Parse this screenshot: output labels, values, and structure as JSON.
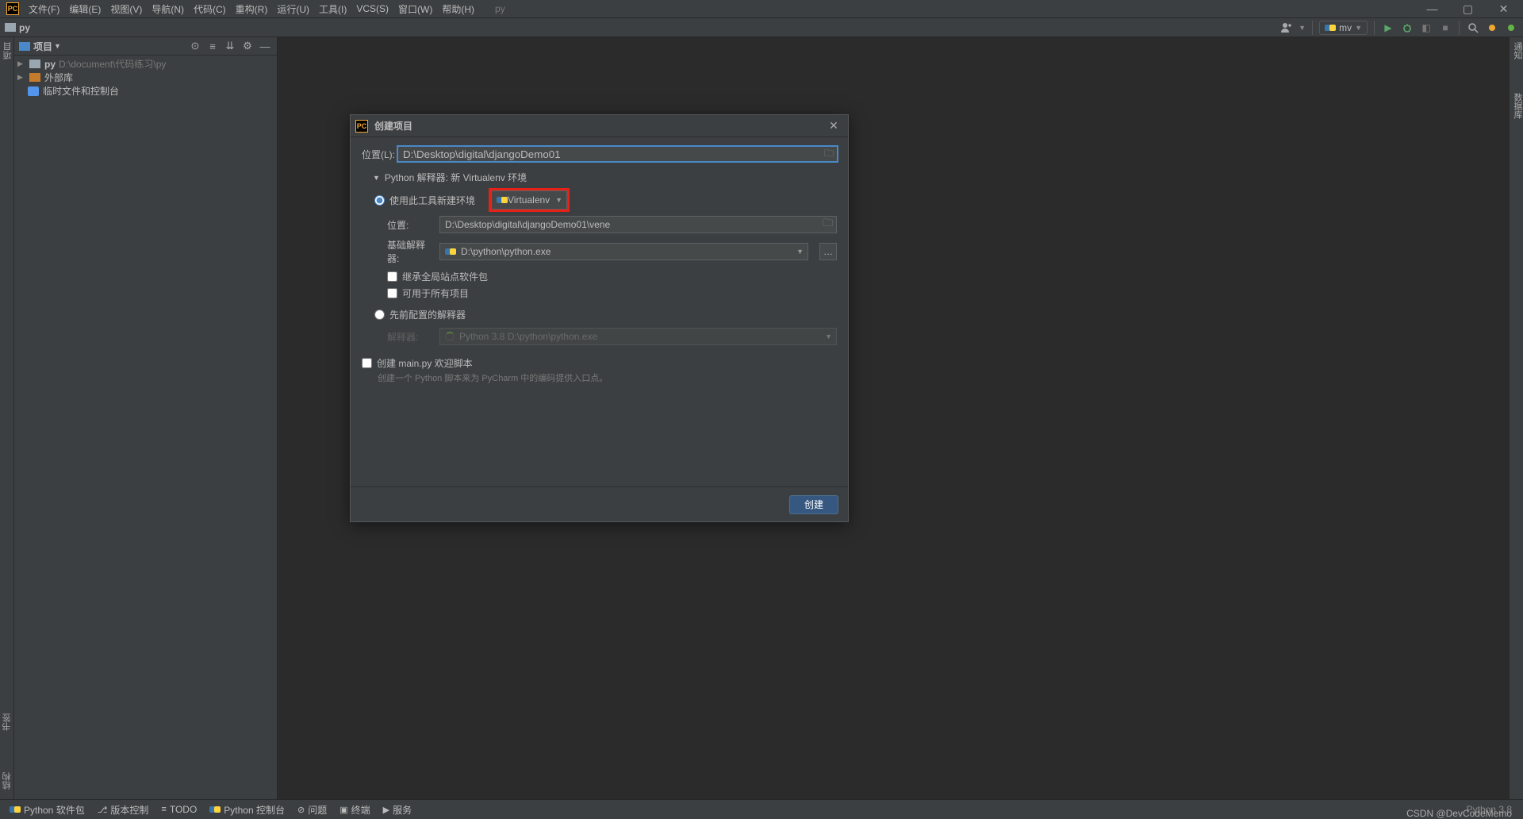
{
  "menubar": {
    "items": [
      "文件(F)",
      "编辑(E)",
      "视图(V)",
      "导航(N)",
      "代码(C)",
      "重构(R)",
      "运行(U)",
      "工具(I)",
      "VCS(S)",
      "窗口(W)",
      "帮助(H)"
    ],
    "title_path": "py"
  },
  "breadcrumb": {
    "text": "py"
  },
  "toolbar_right": {
    "run_config": "mv"
  },
  "left_tabs": {
    "top": "项目",
    "bottom_items": [
      "书签",
      "结构"
    ]
  },
  "right_tabs": {
    "items": [
      "通知",
      "数据库"
    ]
  },
  "project_panel": {
    "title": "项目",
    "tree": [
      {
        "label": "py",
        "path": "D:\\document\\代码练习\\py",
        "kind": "folder"
      },
      {
        "label": "外部库",
        "kind": "lib"
      },
      {
        "label": "临时文件和控制台",
        "kind": "scratch"
      }
    ]
  },
  "statusbar": {
    "items": [
      "Python 软件包",
      "版本控制",
      "TODO",
      "Python 控制台",
      "问题",
      "终端",
      "服务"
    ],
    "right_text": "Python 3.8"
  },
  "watermark": "CSDN @DevCodeMemo",
  "dialog": {
    "title": "创建项目",
    "location_label": "位置(L):",
    "location_value": "D:\\Desktop\\digital\\djangoDemo01",
    "interpreter_section": "Python 解释器: 新 Virtualenv 环境",
    "radio_new_env": "使用此工具新建环境",
    "env_tool": "Virtualenv",
    "venv_location_label": "位置:",
    "venv_location_value": "D:\\Desktop\\digital\\djangoDemo01\\vene",
    "base_interp_label": "基础解释器:",
    "base_interp_value": "D:\\python\\python.exe",
    "check_inherit": "继承全局站点软件包",
    "check_all_projects": "可用于所有项目",
    "radio_existing": "先前配置的解释器",
    "existing_label": "解释器:",
    "existing_value": "Python 3.8 D:\\python\\python.exe",
    "create_main_check": "创建 main.py 欢迎脚本",
    "create_main_hint": "创建一个 Python 脚本来为 PyCharm 中的编码提供入口点。",
    "create_btn": "创建"
  }
}
